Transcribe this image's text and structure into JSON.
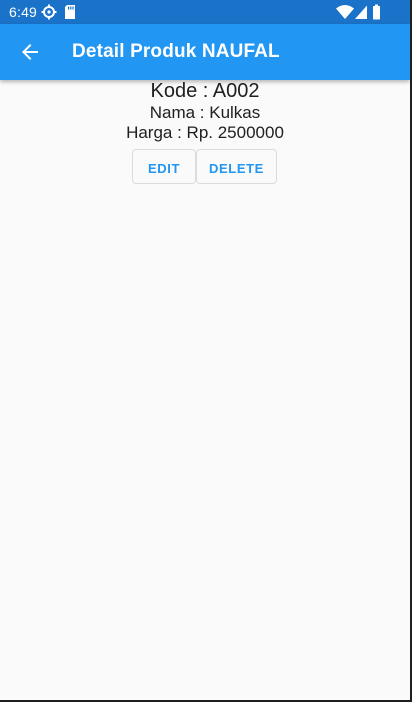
{
  "status_bar": {
    "time": "6:49",
    "left_icons": [
      "settings-gear-icon",
      "sd-card-icon"
    ],
    "right_icons": [
      "wifi-icon",
      "cell-signal-icon",
      "battery-icon"
    ]
  },
  "app_bar": {
    "title": "Detail Produk NAUFAL",
    "back_icon": "arrow-back-icon"
  },
  "product": {
    "kode": "Kode : A002",
    "nama": "Nama : Kulkas",
    "harga": "Harga : Rp. 2500000"
  },
  "actions": {
    "edit_label": "EDIT",
    "delete_label": "DELETE"
  },
  "colors": {
    "status_bar": "#1a73c8",
    "app_bar": "#2196f3",
    "accent": "#2196f3",
    "background": "#fafafa"
  }
}
